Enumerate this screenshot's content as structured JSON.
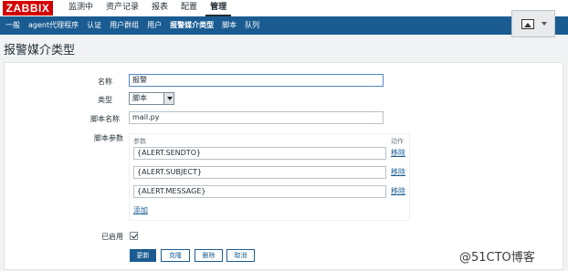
{
  "app": {
    "logo": "ZABBIX"
  },
  "topmenu": [
    {
      "label": "监测中",
      "active": false
    },
    {
      "label": "资产记录",
      "active": false
    },
    {
      "label": "报表",
      "active": false
    },
    {
      "label": "配置",
      "active": false
    },
    {
      "label": "管理",
      "active": true
    }
  ],
  "submenu": [
    {
      "label": "一般",
      "active": false
    },
    {
      "label": "agent代理程序",
      "active": false
    },
    {
      "label": "认证",
      "active": false
    },
    {
      "label": "用户群组",
      "active": false
    },
    {
      "label": "用户",
      "active": false
    },
    {
      "label": "报警媒介类型",
      "active": true
    },
    {
      "label": "脚本",
      "active": false
    },
    {
      "label": "队列",
      "active": false
    }
  ],
  "widget": {
    "icon": "image-icon"
  },
  "page": {
    "title": "报警媒介类型"
  },
  "form": {
    "name_label": "名称",
    "name_value": "报警",
    "type_label": "类型",
    "type_value": "脚本",
    "script_name_label": "脚本名称",
    "script_name_value": "mail.py",
    "script_params_label": "脚本参数",
    "params_header": "参数",
    "action_header": "动作",
    "params": [
      {
        "value": "{ALERT.SENDTO}",
        "remove": "移除"
      },
      {
        "value": "{ALERT.SUBJECT}",
        "remove": "移除"
      },
      {
        "value": "{ALERT.MESSAGE}",
        "remove": "移除"
      }
    ],
    "add_link": "添加",
    "enabled_label": "已启用",
    "enabled": true
  },
  "buttons": {
    "update": "更新",
    "clone": "克隆",
    "delete": "删除",
    "cancel": "取消"
  },
  "watermark": "@51CTO博客"
}
